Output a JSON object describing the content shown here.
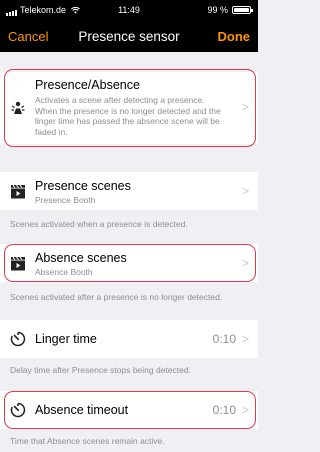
{
  "status_bar": {
    "carrier": "Telekom.de",
    "time": "11:49",
    "battery": "99 %"
  },
  "nav": {
    "cancel": "Cancel",
    "title": "Presence sensor",
    "done": "Done"
  },
  "presence": {
    "title": "Presence/Absence",
    "description": "Activates a scene after detecting a presence. When the presence is no longer detected and the linger time has passed the absence scene will be faded in."
  },
  "presence_scenes": {
    "label": "Presence scenes",
    "value": "Presence Booth",
    "footnote": "Scenes activated when a presence is detected."
  },
  "absence_scenes": {
    "label": "Absence scenes",
    "value": "Absence Booth",
    "footnote": "Scenes activated after a presence is no longer detected."
  },
  "linger_time": {
    "label": "Linger time",
    "value": "0:10",
    "footnote": "Delay time after Presence stops being detected."
  },
  "absence_timeout": {
    "label": "Absence timeout",
    "value": "0:10",
    "footnote": "Time that Absence scenes remain active."
  },
  "colors": {
    "accent": "#ff9500",
    "highlight": "#e23b4a"
  }
}
